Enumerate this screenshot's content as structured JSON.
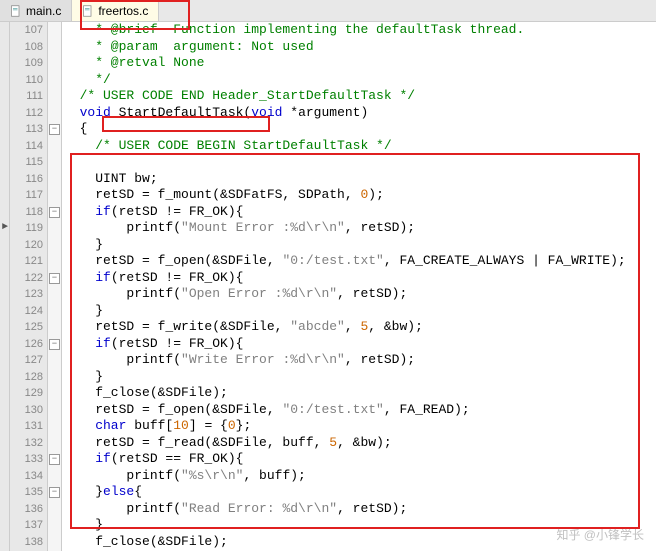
{
  "tabs": [
    {
      "label": "main.c",
      "active": false
    },
    {
      "label": "freertos.c",
      "active": true
    }
  ],
  "lines": [
    {
      "n": 107,
      "fold": "",
      "tokens": [
        [
          "c-comment",
          "    * @brief  Function implementing the defaultTask thread."
        ]
      ]
    },
    {
      "n": 108,
      "fold": "",
      "tokens": [
        [
          "c-comment",
          "    * @param  argument: Not used"
        ]
      ]
    },
    {
      "n": 109,
      "fold": "",
      "tokens": [
        [
          "c-comment",
          "    * @retval None"
        ]
      ]
    },
    {
      "n": 110,
      "fold": "",
      "tokens": [
        [
          "c-comment",
          "    */"
        ]
      ]
    },
    {
      "n": 111,
      "fold": "",
      "tokens": [
        [
          "c-comment",
          "  /* USER CODE END Header_StartDefaultTask */"
        ]
      ]
    },
    {
      "n": 112,
      "fold": "",
      "tokens": [
        [
          "c-keyword",
          "  void"
        ],
        [
          "c-plain",
          " StartDefaultTask("
        ],
        [
          "c-keyword",
          "void"
        ],
        [
          "c-plain",
          " *argument)"
        ]
      ]
    },
    {
      "n": 113,
      "fold": "-",
      "tokens": [
        [
          "c-plain",
          "  {"
        ]
      ]
    },
    {
      "n": 114,
      "fold": "",
      "tokens": [
        [
          "c-comment",
          "    /* USER CODE BEGIN StartDefaultTask */"
        ]
      ]
    },
    {
      "n": 115,
      "fold": "",
      "tokens": [
        [
          "c-plain",
          ""
        ]
      ]
    },
    {
      "n": 116,
      "fold": "",
      "tokens": [
        [
          "c-plain",
          "    UINT bw;"
        ]
      ]
    },
    {
      "n": 117,
      "fold": "",
      "tokens": [
        [
          "c-plain",
          "    retSD = f_mount(&SDFatFS, SDPath, "
        ],
        [
          "c-number",
          "0"
        ],
        [
          "c-plain",
          ");"
        ]
      ]
    },
    {
      "n": 118,
      "fold": "-",
      "tokens": [
        [
          "c-keyword",
          "    if"
        ],
        [
          "c-plain",
          "(retSD != FR_OK){"
        ]
      ]
    },
    {
      "n": 119,
      "fold": "",
      "tokens": [
        [
          "c-plain",
          "        printf("
        ],
        [
          "c-string",
          "\"Mount Error :%d\\r\\n\""
        ],
        [
          "c-plain",
          ", retSD);"
        ]
      ],
      "mark": "►"
    },
    {
      "n": 120,
      "fold": "",
      "tokens": [
        [
          "c-plain",
          "    }"
        ]
      ]
    },
    {
      "n": 121,
      "fold": "",
      "tokens": [
        [
          "c-plain",
          "    retSD = f_open(&SDFile, "
        ],
        [
          "c-string",
          "\"0:/test.txt\""
        ],
        [
          "c-plain",
          ", FA_CREATE_ALWAYS | FA_WRITE);"
        ]
      ]
    },
    {
      "n": 122,
      "fold": "-",
      "tokens": [
        [
          "c-keyword",
          "    if"
        ],
        [
          "c-plain",
          "(retSD != FR_OK){"
        ]
      ]
    },
    {
      "n": 123,
      "fold": "",
      "tokens": [
        [
          "c-plain",
          "        printf("
        ],
        [
          "c-string",
          "\"Open Error :%d\\r\\n\""
        ],
        [
          "c-plain",
          ", retSD);"
        ]
      ]
    },
    {
      "n": 124,
      "fold": "",
      "tokens": [
        [
          "c-plain",
          "    }"
        ]
      ]
    },
    {
      "n": 125,
      "fold": "",
      "tokens": [
        [
          "c-plain",
          "    retSD = f_write(&SDFile, "
        ],
        [
          "c-string",
          "\"abcde\""
        ],
        [
          "c-plain",
          ", "
        ],
        [
          "c-number",
          "5"
        ],
        [
          "c-plain",
          ", &bw);"
        ]
      ]
    },
    {
      "n": 126,
      "fold": "-",
      "tokens": [
        [
          "c-keyword",
          "    if"
        ],
        [
          "c-plain",
          "(retSD != FR_OK){"
        ]
      ]
    },
    {
      "n": 127,
      "fold": "",
      "tokens": [
        [
          "c-plain",
          "        printf("
        ],
        [
          "c-string",
          "\"Write Error :%d\\r\\n\""
        ],
        [
          "c-plain",
          ", retSD);"
        ]
      ]
    },
    {
      "n": 128,
      "fold": "",
      "tokens": [
        [
          "c-plain",
          "    }"
        ]
      ]
    },
    {
      "n": 129,
      "fold": "",
      "tokens": [
        [
          "c-plain",
          "    f_close(&SDFile);"
        ]
      ]
    },
    {
      "n": 130,
      "fold": "",
      "tokens": [
        [
          "c-plain",
          "    retSD = f_open(&SDFile, "
        ],
        [
          "c-string",
          "\"0:/test.txt\""
        ],
        [
          "c-plain",
          ", FA_READ);"
        ]
      ]
    },
    {
      "n": 131,
      "fold": "",
      "tokens": [
        [
          "c-keyword",
          "    char"
        ],
        [
          "c-plain",
          " buff["
        ],
        [
          "c-number",
          "10"
        ],
        [
          "c-plain",
          "] = {"
        ],
        [
          "c-number",
          "0"
        ],
        [
          "c-plain",
          "};"
        ]
      ]
    },
    {
      "n": 132,
      "fold": "",
      "tokens": [
        [
          "c-plain",
          "    retSD = f_read(&SDFile, buff, "
        ],
        [
          "c-number",
          "5"
        ],
        [
          "c-plain",
          ", &bw);"
        ]
      ]
    },
    {
      "n": 133,
      "fold": "-",
      "tokens": [
        [
          "c-keyword",
          "    if"
        ],
        [
          "c-plain",
          "(retSD == FR_OK){"
        ]
      ]
    },
    {
      "n": 134,
      "fold": "",
      "tokens": [
        [
          "c-plain",
          "        printf("
        ],
        [
          "c-string",
          "\"%s\\r\\n\""
        ],
        [
          "c-plain",
          ", buff);"
        ]
      ]
    },
    {
      "n": 135,
      "fold": "-",
      "tokens": [
        [
          "c-plain",
          "    }"
        ],
        [
          "c-keyword",
          "else"
        ],
        [
          "c-plain",
          "{"
        ]
      ]
    },
    {
      "n": 136,
      "fold": "",
      "tokens": [
        [
          "c-plain",
          "        printf("
        ],
        [
          "c-string",
          "\"Read Error: %d\\r\\n\""
        ],
        [
          "c-plain",
          ", retSD);"
        ]
      ]
    },
    {
      "n": 137,
      "fold": "",
      "tokens": [
        [
          "c-plain",
          "    }"
        ]
      ]
    },
    {
      "n": 138,
      "fold": "",
      "tokens": [
        [
          "c-plain",
          "    f_close(&SDFile);"
        ]
      ]
    }
  ],
  "watermark": "知乎 @小锋学长"
}
